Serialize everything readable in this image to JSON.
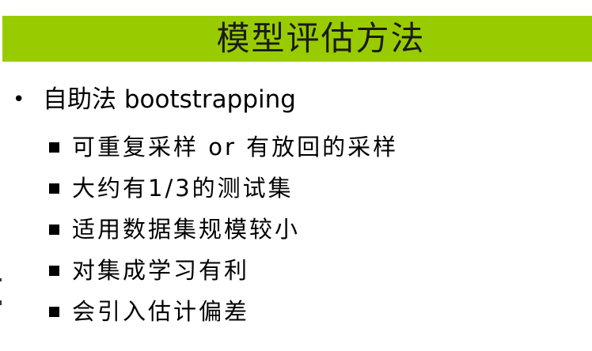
{
  "title": "模型评估方法",
  "bullet": {
    "symbol": "•",
    "text": "自助法 bootstrapping"
  },
  "sub_items": [
    "可重复采样 or 有放回的采样",
    "大约有1/3的测试集",
    "适用数据集规模较小",
    "对集成学习有利",
    "会引入估计偏差"
  ],
  "colors": {
    "title_bar": "#99cc00",
    "background": "#ffffff",
    "text": "#000000"
  }
}
